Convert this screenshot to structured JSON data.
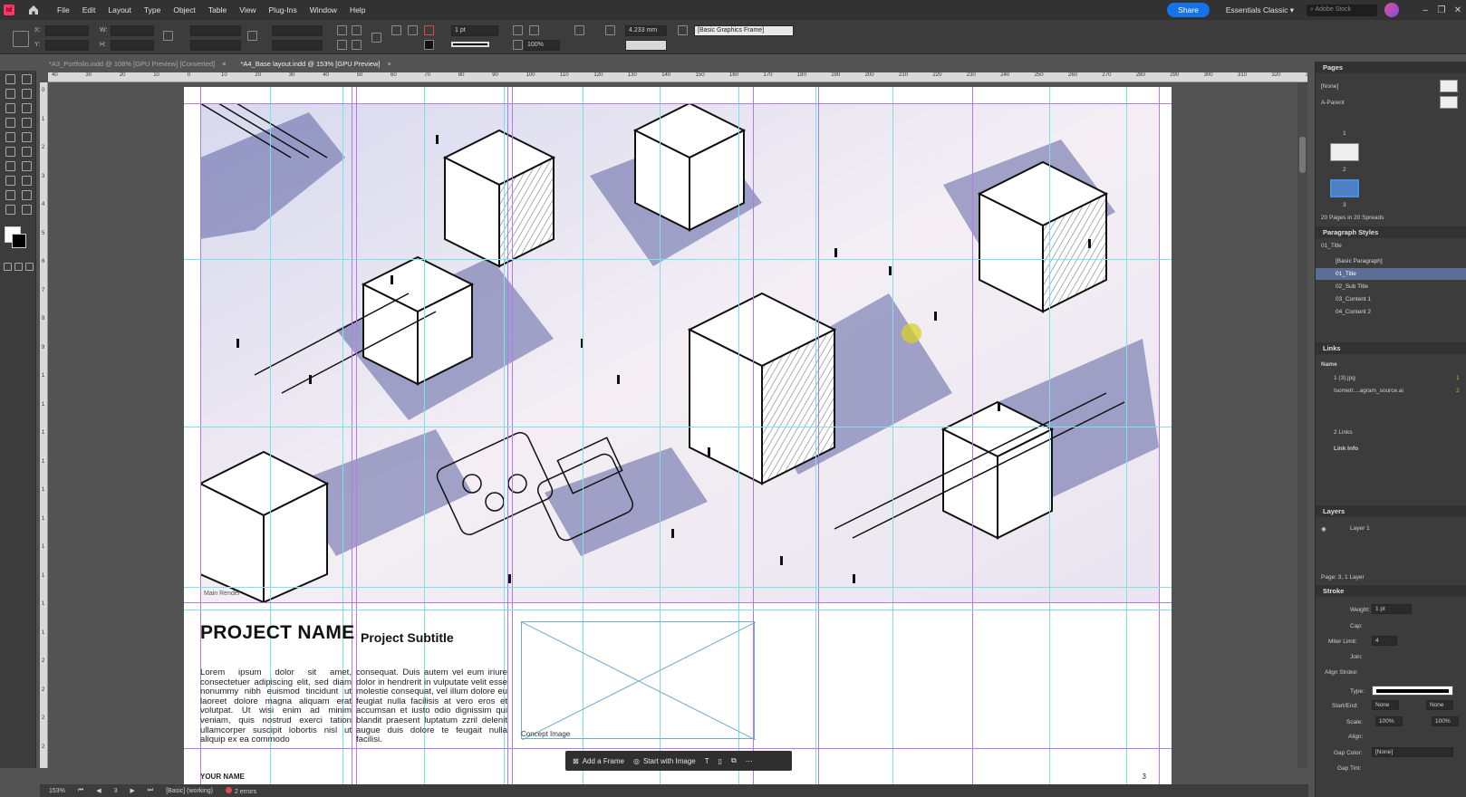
{
  "app": {
    "logo": "Id",
    "colors": {
      "accent": "#1473e6",
      "brand": "#ff3366",
      "guide_cyan": "#79e3ea",
      "guide_violet": "#b27ae8",
      "selection": "#5b6e93"
    }
  },
  "menu": [
    "File",
    "Edit",
    "Layout",
    "Type",
    "Object",
    "Table",
    "View",
    "Plug-Ins",
    "Window",
    "Help"
  ],
  "topbar": {
    "share": "Share",
    "workspace": "Essentials Classic",
    "search_placeholder": "Adobe Stock"
  },
  "control": {
    "x_label": "X:",
    "y_label": "Y:",
    "w_label": "W:",
    "h_label": "H:",
    "stroke_weight": "1 pt",
    "ref_value": "4.233 mm",
    "scale": "100%",
    "object_style": "[Basic Graphics Frame]"
  },
  "tabs": [
    {
      "label": "*A3_Portfolio.indd @ 108% [GPU Preview] [Converted]",
      "active": false
    },
    {
      "label": "*A4_Base layout.indd @ 153% [GPU Preview]",
      "active": true
    }
  ],
  "ruler_h": [
    "40",
    "30",
    "20",
    "10",
    "0",
    "10",
    "20",
    "30",
    "40",
    "50",
    "60",
    "70",
    "80",
    "90",
    "100",
    "110",
    "120",
    "130",
    "140",
    "150",
    "160",
    "170",
    "180",
    "190",
    "200",
    "210",
    "220",
    "230",
    "240",
    "250",
    "260",
    "270",
    "280",
    "290",
    "300",
    "310",
    "320",
    "330"
  ],
  "ruler_v": [
    "0",
    "1",
    "2",
    "3",
    "4",
    "5",
    "6",
    "7",
    "8",
    "9",
    "1",
    "1",
    "1",
    "1",
    "1",
    "1",
    "1",
    "1",
    "1",
    "1",
    "2",
    "2",
    "2",
    "2"
  ],
  "document": {
    "project_name": "PROJECT NAME",
    "project_subtitle": "Project Subtitle",
    "lorem_col1": "Lorem ipsum dolor sit amet, consectetuer adipiscing elit, sed diam nonummy nibh euismod tincidunt ut laoreet dolore magna aliquam erat volutpat. Ut wisi enim ad minim veniam, quis nostrud exerci tation ullamcorper suscipit lobortis nisl ut aliquip ex ea commodo",
    "lorem_col2": "consequat. Duis autem vel eum iriure dolor in hendrerit in vulputate velit esse molestie consequat, vel illum dolore eu feugiat nulla facilisis at vero eros et accumsan et iusto odio dignissim qui blandit praesent luptatum zzril delenit augue duis dolore te feugait nulla facilisi.",
    "concept_label": "Concept Image",
    "main_label": "Main Render",
    "your_name": "YOUR NAME",
    "page_number": "3"
  },
  "context_bar": {
    "add_frame": "Add a Frame",
    "start_with_image": "Start with Image"
  },
  "status": {
    "zoom": "153%",
    "page": "3",
    "style": "[Basic] (working)",
    "errors": "2 errors"
  },
  "pages_panel": {
    "title": "Pages",
    "none": "[None]",
    "parent": "A-Parent",
    "page_labels": [
      "1",
      "2",
      "3"
    ],
    "count": "20 Pages in 20 Spreads"
  },
  "para_panel": {
    "title": "Paragraph Styles",
    "current": "01_Title",
    "items": [
      "[Basic Paragraph]",
      "01_Title",
      "02_Sub Title",
      "03_Content 1",
      "04_Content 2"
    ],
    "selected_index": 1
  },
  "links_panel": {
    "title": "Links",
    "col_name": "Name",
    "items": [
      {
        "name": "1 (3).jpg",
        "page": "1"
      },
      {
        "name": "Isometr....agram_source.ai",
        "page": "2"
      }
    ],
    "count": "2 Links",
    "info": "Link Info"
  },
  "layers_panel": {
    "title": "Layers",
    "layer": "Layer 1",
    "footer": "Page: 3, 1 Layer"
  },
  "stroke_panel": {
    "title": "Stroke",
    "weight_label": "Weight:",
    "weight": "1 pt",
    "cap_label": "Cap:",
    "miter_label": "Miter Limit:",
    "miter": "4",
    "join_label": "Join:",
    "align_label": "Align Stroke:",
    "type_label": "Type:",
    "start_end_label": "Start/End:",
    "start": "None",
    "end": "None",
    "scale_label": "Scale:",
    "scale1": "100%",
    "scale2": "100%",
    "align2_label": "Align:",
    "gap_color_label": "Gap Color:",
    "gap_color": "[None]",
    "gap_tint_label": "Gap Tint:"
  }
}
